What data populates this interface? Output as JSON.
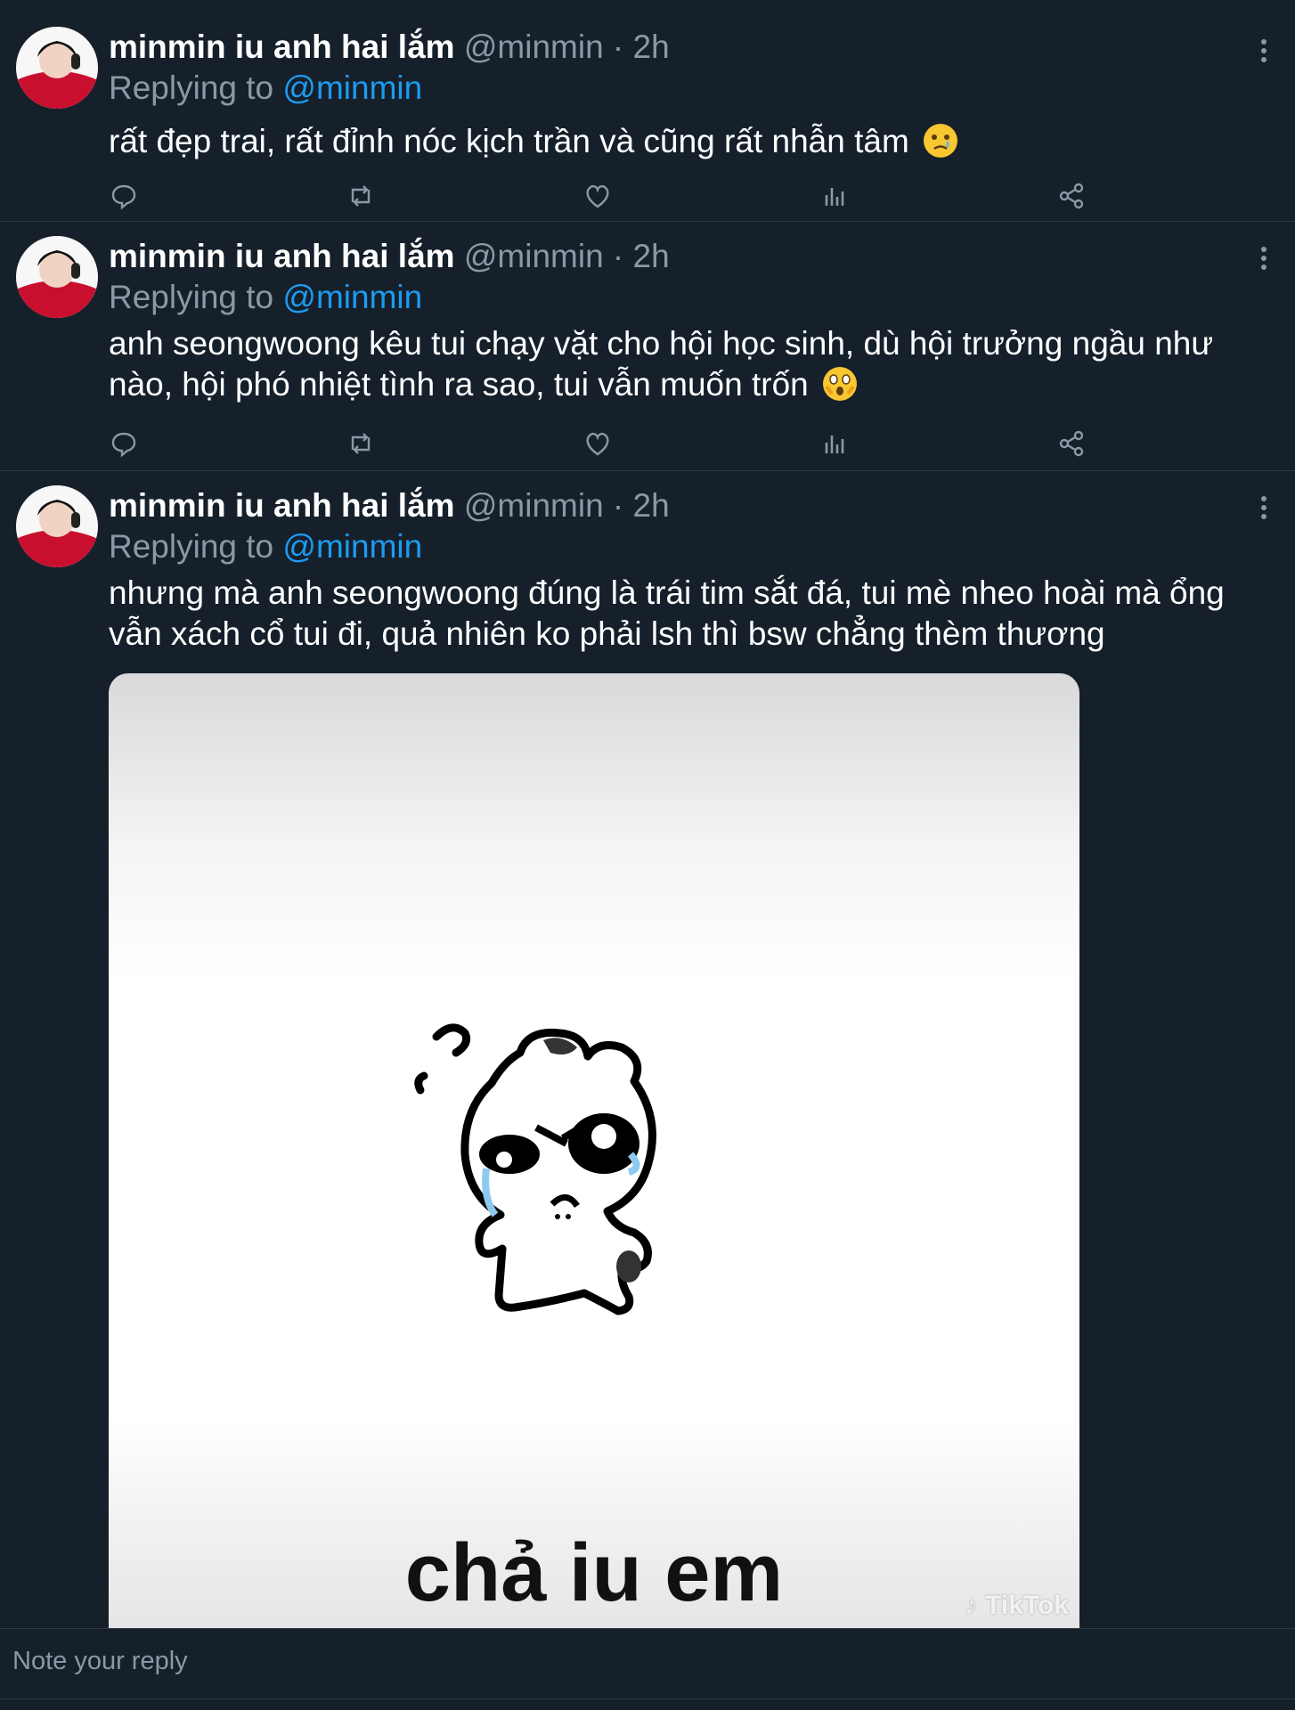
{
  "tweets": [
    {
      "name": "minmin iu anh hai lắm",
      "handle": "@minmin · 2h",
      "replying_prefix": "Replying to ",
      "replying_mention": "@minmin",
      "text": "rất đẹp trai, rất đỉnh nóc kịch trần và cũng rất nhẫn tâm",
      "emoji": "crying-face"
    },
    {
      "name": "minmin iu anh hai lắm",
      "handle": "@minmin · 2h",
      "replying_prefix": "Replying to ",
      "replying_mention": "@minmin",
      "text": "anh seongwoong kêu tui chạy vặt cho hội học sinh, dù hội trưởng ngầu như nào, hội phó nhiệt tình ra sao, tui vẫn muốn trốn",
      "emoji": "face-holding-back-tears"
    },
    {
      "name": "minmin iu anh hai lắm",
      "handle": "@minmin · 2h",
      "replying_prefix": "Replying to ",
      "replying_mention": "@minmin",
      "text": "nhưng mà anh seongwoong đúng là trái tim sắt đá, tui mè nheo hoài mà ổng vẫn xách cổ tui đi, quả nhiên ko phải lsh thì bsw chẳng thèm thương",
      "media": {
        "caption": "chả iu em",
        "watermark": "TikTok"
      }
    }
  ],
  "actions": [
    "reply-icon",
    "retweet-icon",
    "like-icon",
    "views-icon",
    "share-icon"
  ],
  "composer": {
    "placeholder": "Note your reply"
  },
  "colors": {
    "background": "#15202b",
    "accent": "#1d9bf0",
    "muted": "#8b98a5",
    "divider": "#2f3b47"
  }
}
